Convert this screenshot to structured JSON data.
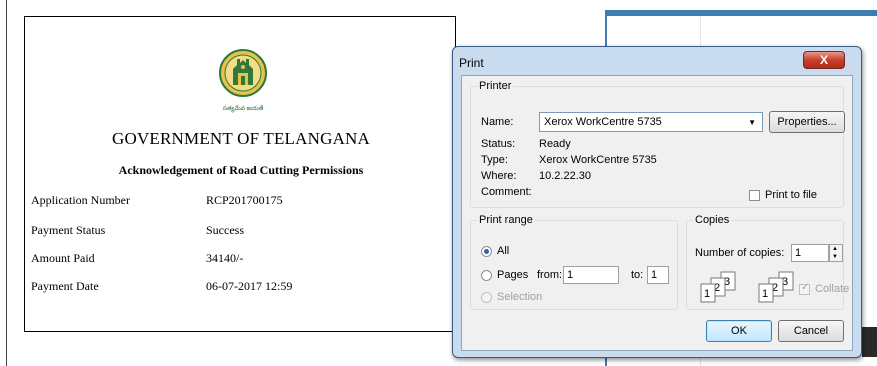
{
  "receipt": {
    "emblem_caption": "సత్యమేవ జయతే",
    "gov_title": "GOVERNMENT OF TELANGANA",
    "ack_title": "Acknowledgement of Road Cutting Permissions",
    "rows": [
      {
        "label": "Application Number",
        "value": "RCP201700175"
      },
      {
        "label": "Payment Status",
        "value": "Success"
      },
      {
        "label": "Amount Paid",
        "value": "34140/-"
      },
      {
        "label": "Payment Date",
        "value": "06-07-2017 12:59"
      }
    ]
  },
  "dialog": {
    "title": "Print",
    "close_label": "X",
    "printer": {
      "group_label": "Printer",
      "name_label": "Name:",
      "name_value": "Xerox WorkCentre 5735",
      "properties_label": "Properties...",
      "status_label": "Status:",
      "status_value": "Ready",
      "type_label": "Type:",
      "type_value": "Xerox WorkCentre 5735",
      "where_label": "Where:",
      "where_value": "10.2.22.30",
      "comment_label": "Comment:",
      "print_to_file_label": "Print to file"
    },
    "range": {
      "group_label": "Print range",
      "all_label": "All",
      "pages_label": "Pages",
      "from_label": "from:",
      "from_value": "1",
      "to_label": "to:",
      "to_value": "1",
      "selection_label": "Selection"
    },
    "copies": {
      "group_label": "Copies",
      "number_label": "Number of copies:",
      "number_value": "1",
      "collate_label": "Collate"
    },
    "ok_label": "OK",
    "cancel_label": "Cancel"
  },
  "colors": {
    "dialog_frame": "#c8dbef",
    "close_button": "#c6402a",
    "accent_blue": "#3e7cb1"
  }
}
